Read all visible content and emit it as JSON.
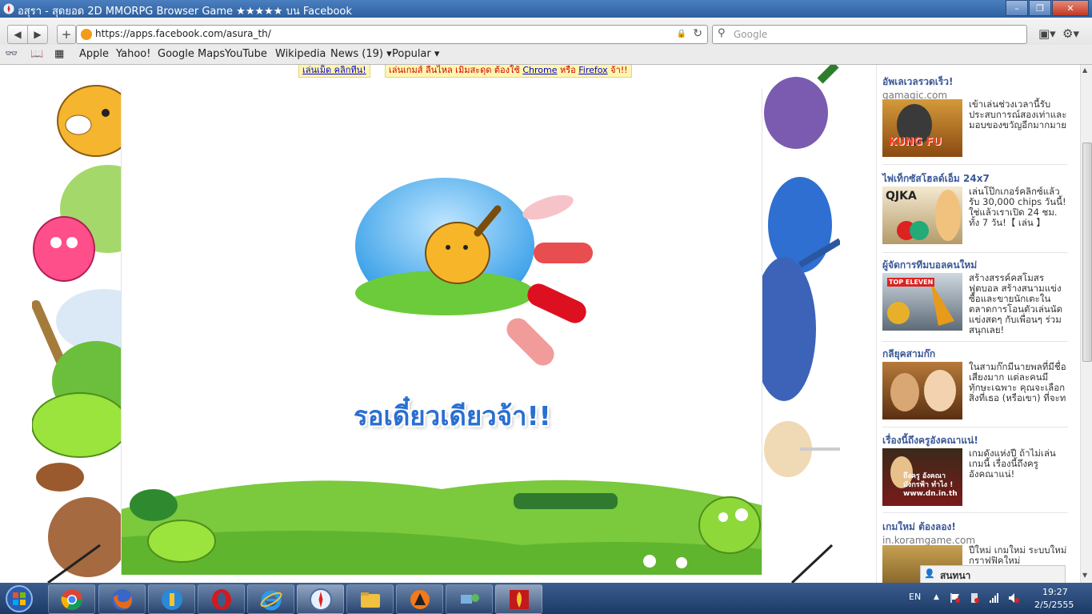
{
  "window": {
    "title": "อสุรา - สุดยอด 2D MMORPG Browser Game ★★★★★ บน Facebook",
    "minimize": "–",
    "maximize": "❐",
    "close": "✕"
  },
  "navbar": {
    "back": "◀",
    "forward": "▶",
    "new_tab": "+",
    "url": "https://apps.facebook.com/asura_th/",
    "lock_icon": "🔒",
    "reload": "↻",
    "search_placeholder": "Google",
    "search_icon": "⚲",
    "page_menu": "▣▾",
    "settings_menu": "⚙▾"
  },
  "bookmarks": {
    "reading_list_icon": "👓",
    "book_icon": "📖",
    "grid_icon": "▦",
    "items": [
      {
        "label": "Apple"
      },
      {
        "label": "Yahoo!"
      },
      {
        "label": "Google Maps"
      },
      {
        "label": "YouTube"
      },
      {
        "label": "Wikipedia"
      },
      {
        "label": "News (19)"
      },
      {
        "label": "Popular"
      }
    ],
    "dropdown_caret": "▾"
  },
  "game": {
    "notice_left": "เล่นเม็ด คลิกทีน!",
    "notice_right_prefix": "เล่นเกมส์ ลื่นไหล เมิ่มสะดุด ต้องใช้",
    "notice_link_chrome": "Chrome",
    "notice_or": "หรือ",
    "notice_link_firefox": "Firefox",
    "notice_suffix": "จ้า!!",
    "loading_text": "รอเดี๋ยวเดียวจ้า!!"
  },
  "ads": [
    {
      "title": "อัพเลเวลรวดเร็ว!",
      "domain": "gamagic.com",
      "image_caption": "KUNG FU",
      "text": "เข้าเล่นช่วงเวลานี้รับประสบการณ์สองเท่าและมอบของขวัญอีกมากมาย"
    },
    {
      "title": "ไพ่เท็กซัสโฮลด์เอ็ม 24x7",
      "domain": "",
      "image_caption": "QJKA",
      "text": "เล่นโป๊กเกอร์คลิกซ์แล้วรับ 30,000 chips วันนี้! ใช่แล้วเราเปิด 24 ชม. ทั้ง 7 วัน!【 เล่น 】"
    },
    {
      "title": "ผู้จัดการทีมบอลคนใหม่",
      "domain": "",
      "image_caption": "TOP ELEVEN",
      "text": "สร้างสรรค์คสโมสรฟุตบอล สร้างสนามแข่ง ซื้อและขายนักเตะในตลาดการโอนตัวเล่นนัดแข่งสดๆ กับเพื่อนๆ ร่วมสนุกเลย!"
    },
    {
      "title": "กลียุคสามก๊ก",
      "domain": "",
      "image_caption": "",
      "text": "ในสามก๊กมีนายพลที่มีชื่อเสียงมาก แต่ละคนมีทักษะเฉพาะ คุณจะเลือกสิ่งที่เธอ (หรือเขา) ที่จะท"
    },
    {
      "title": "เรื่องนี้ถึงครูอังคณาแน่!",
      "domain": "",
      "image_caption": "ถึงครู อังคณา มังกรฟ้า ทำไง ! www.dn.in.th",
      "text": "เกมดังแห่งปี ถ้าไม่เล่นเกมนี้ เรื่องนี้ถึงครูอังคณาแน่!"
    },
    {
      "title": "เกมใหม่ ต้องลอง!",
      "domain": "in.koramgame.com",
      "image_caption": "",
      "text": "ปีใหม่ เกมใหม่ ระบบใหม่ กราฟฟิคใหม่"
    }
  ],
  "chat": {
    "label": "สนทนา",
    "icon": "👤"
  },
  "taskbar": {
    "start_icon": "windows-orb",
    "apps": [
      "chrome",
      "firefox",
      "app-blue",
      "opera",
      "internet-explorer",
      "safari",
      "file-explorer",
      "avast",
      "network-app",
      "asura-game"
    ],
    "tray": {
      "lang": "EN",
      "up_arrow": "▲",
      "time": "19:27",
      "date": "2/5/2555"
    }
  },
  "colors": {
    "fb_blue": "#3b5998",
    "loading_blue": "#2a6fd1",
    "taskbar": "#1d3a66",
    "titlebar": "#2f5f9e"
  }
}
